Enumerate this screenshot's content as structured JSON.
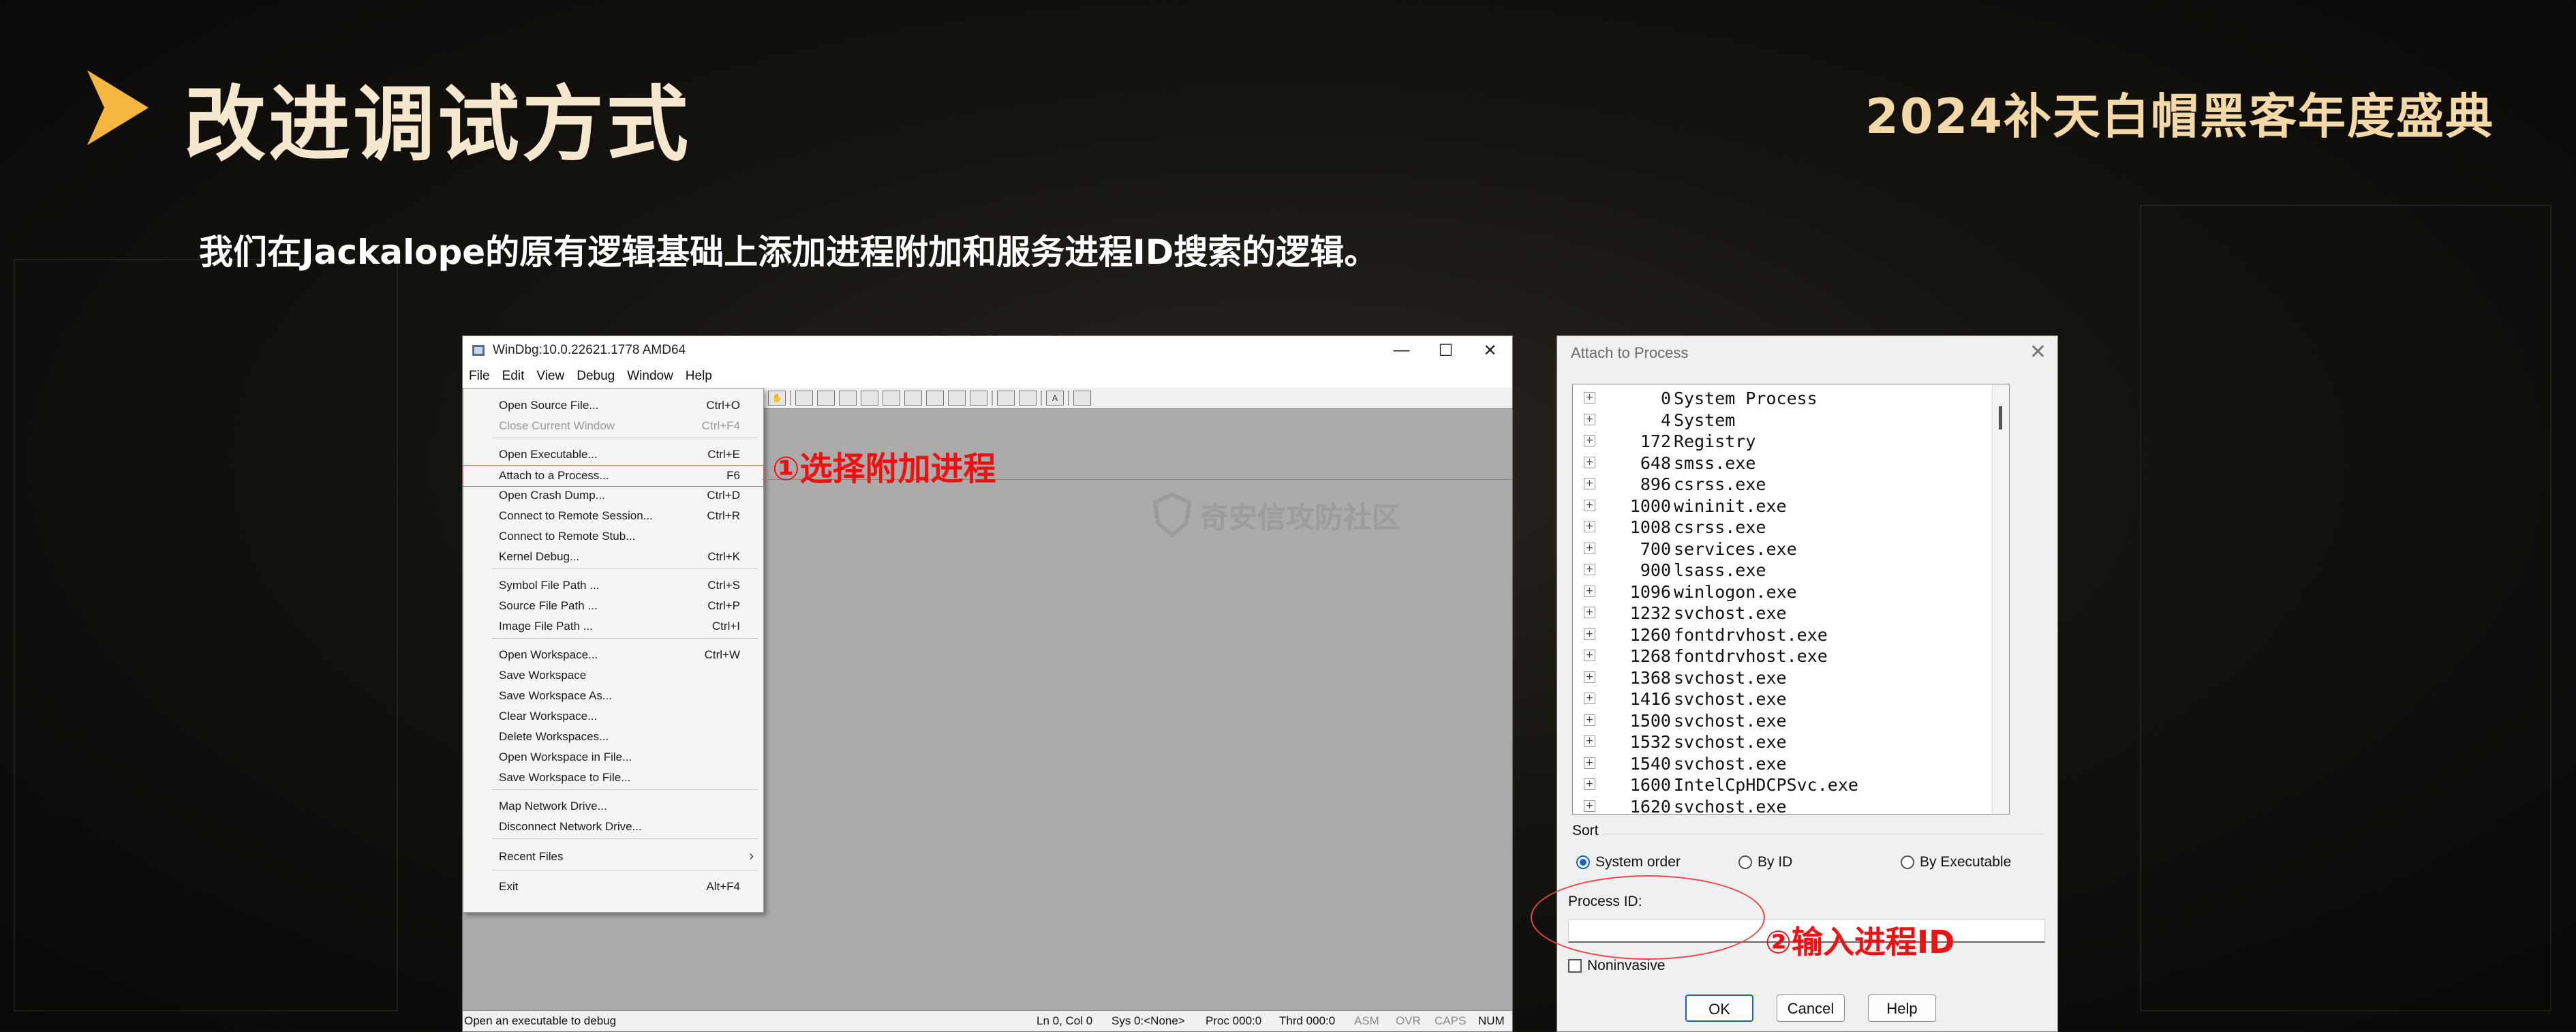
{
  "slide": {
    "title": "改进调试方式",
    "brand": "2024补天白帽黑客年度盛典",
    "subtitle": "我们在Jackalope的原有逻辑基础上添加进程附加和服务进程ID搜索的逻辑。"
  },
  "windbg": {
    "title": "WinDbg:10.0.22621.1778 AMD64",
    "controls": [
      "—",
      "☐",
      "✕"
    ],
    "menus": [
      "File",
      "Edit",
      "View",
      "Debug",
      "Window",
      "Help"
    ],
    "file_menu": [
      {
        "label": "Open Source File...",
        "shortcut": "Ctrl+O",
        "disabled": false
      },
      {
        "label": "Close Current Window",
        "shortcut": "Ctrl+F4",
        "disabled": true
      },
      {
        "label": "Open Executable...",
        "shortcut": "Ctrl+E",
        "disabled": false
      },
      {
        "label": "Attach to a Process...",
        "shortcut": "F6",
        "disabled": false
      },
      {
        "label": "Open Crash Dump...",
        "shortcut": "Ctrl+D",
        "disabled": false
      },
      {
        "label": "Connect to Remote Session...",
        "shortcut": "Ctrl+R",
        "disabled": false
      },
      {
        "label": "Connect to Remote Stub...",
        "shortcut": "",
        "disabled": false
      },
      {
        "label": "Kernel Debug...",
        "shortcut": "Ctrl+K",
        "disabled": false
      },
      {
        "label": "Symbol File Path ...",
        "shortcut": "Ctrl+S",
        "disabled": false
      },
      {
        "label": "Source File Path ...",
        "shortcut": "Ctrl+P",
        "disabled": false
      },
      {
        "label": "Image File Path ...",
        "shortcut": "Ctrl+I",
        "disabled": false
      },
      {
        "label": "Open Workspace...",
        "shortcut": "Ctrl+W",
        "disabled": false
      },
      {
        "label": "Save Workspace",
        "shortcut": "",
        "disabled": false
      },
      {
        "label": "Save Workspace As...",
        "shortcut": "",
        "disabled": false
      },
      {
        "label": "Clear Workspace...",
        "shortcut": "",
        "disabled": false
      },
      {
        "label": "Delete Workspaces...",
        "shortcut": "",
        "disabled": false
      },
      {
        "label": "Open Workspace in File...",
        "shortcut": "",
        "disabled": false
      },
      {
        "label": "Save Workspace to File...",
        "shortcut": "",
        "disabled": false
      },
      {
        "label": "Map Network Drive...",
        "shortcut": "",
        "disabled": false
      },
      {
        "label": "Disconnect Network Drive...",
        "shortcut": "",
        "disabled": false
      },
      {
        "label": "Recent Files",
        "shortcut": "",
        "disabled": false,
        "submenu": true
      },
      {
        "label": "Exit",
        "shortcut": "Alt+F4",
        "disabled": false
      }
    ],
    "annotation": "①选择附加进程",
    "watermark": "奇安信攻防社区",
    "status": {
      "message": "Open an executable to debug",
      "cells": [
        "Ln 0, Col 0",
        "Sys 0:<None>",
        "Proc 000:0",
        "Thrd 000:0",
        "ASM",
        "OVR",
        "CAPS",
        "NUM"
      ]
    }
  },
  "attach_dialog": {
    "title": "Attach to Process",
    "close": "✕",
    "processes": [
      {
        "pid": "0",
        "name": "System Process"
      },
      {
        "pid": "4",
        "name": "System"
      },
      {
        "pid": "172",
        "name": "Registry"
      },
      {
        "pid": "648",
        "name": "smss.exe"
      },
      {
        "pid": "896",
        "name": "csrss.exe"
      },
      {
        "pid": "1000",
        "name": "wininit.exe"
      },
      {
        "pid": "1008",
        "name": "csrss.exe"
      },
      {
        "pid": "700",
        "name": "services.exe"
      },
      {
        "pid": "900",
        "name": "lsass.exe"
      },
      {
        "pid": "1096",
        "name": "winlogon.exe"
      },
      {
        "pid": "1232",
        "name": "svchost.exe"
      },
      {
        "pid": "1260",
        "name": "fontdrvhost.exe"
      },
      {
        "pid": "1268",
        "name": "fontdrvhost.exe"
      },
      {
        "pid": "1368",
        "name": "svchost.exe"
      },
      {
        "pid": "1416",
        "name": "svchost.exe"
      },
      {
        "pid": "1500",
        "name": "svchost.exe"
      },
      {
        "pid": "1532",
        "name": "svchost.exe"
      },
      {
        "pid": "1540",
        "name": "svchost.exe"
      },
      {
        "pid": "1600",
        "name": "IntelCpHDCPSvc.exe"
      },
      {
        "pid": "1620",
        "name": "svchost.exe"
      }
    ],
    "sort_label": "Sort",
    "sort_options": [
      "System order",
      "By ID",
      "By Executable"
    ],
    "sort_selected": "System order",
    "pid_label": "Process ID:",
    "pid_value": "",
    "noninvasive_label": "Noninvasive",
    "buttons": {
      "ok": "OK",
      "cancel": "Cancel",
      "help": "Help"
    },
    "annotation": "②输入进程ID"
  },
  "colors": {
    "annotation": "#ee1111",
    "title": "#f6e8cf",
    "brand": "#f3d9a8",
    "accent": "#f5b640"
  }
}
